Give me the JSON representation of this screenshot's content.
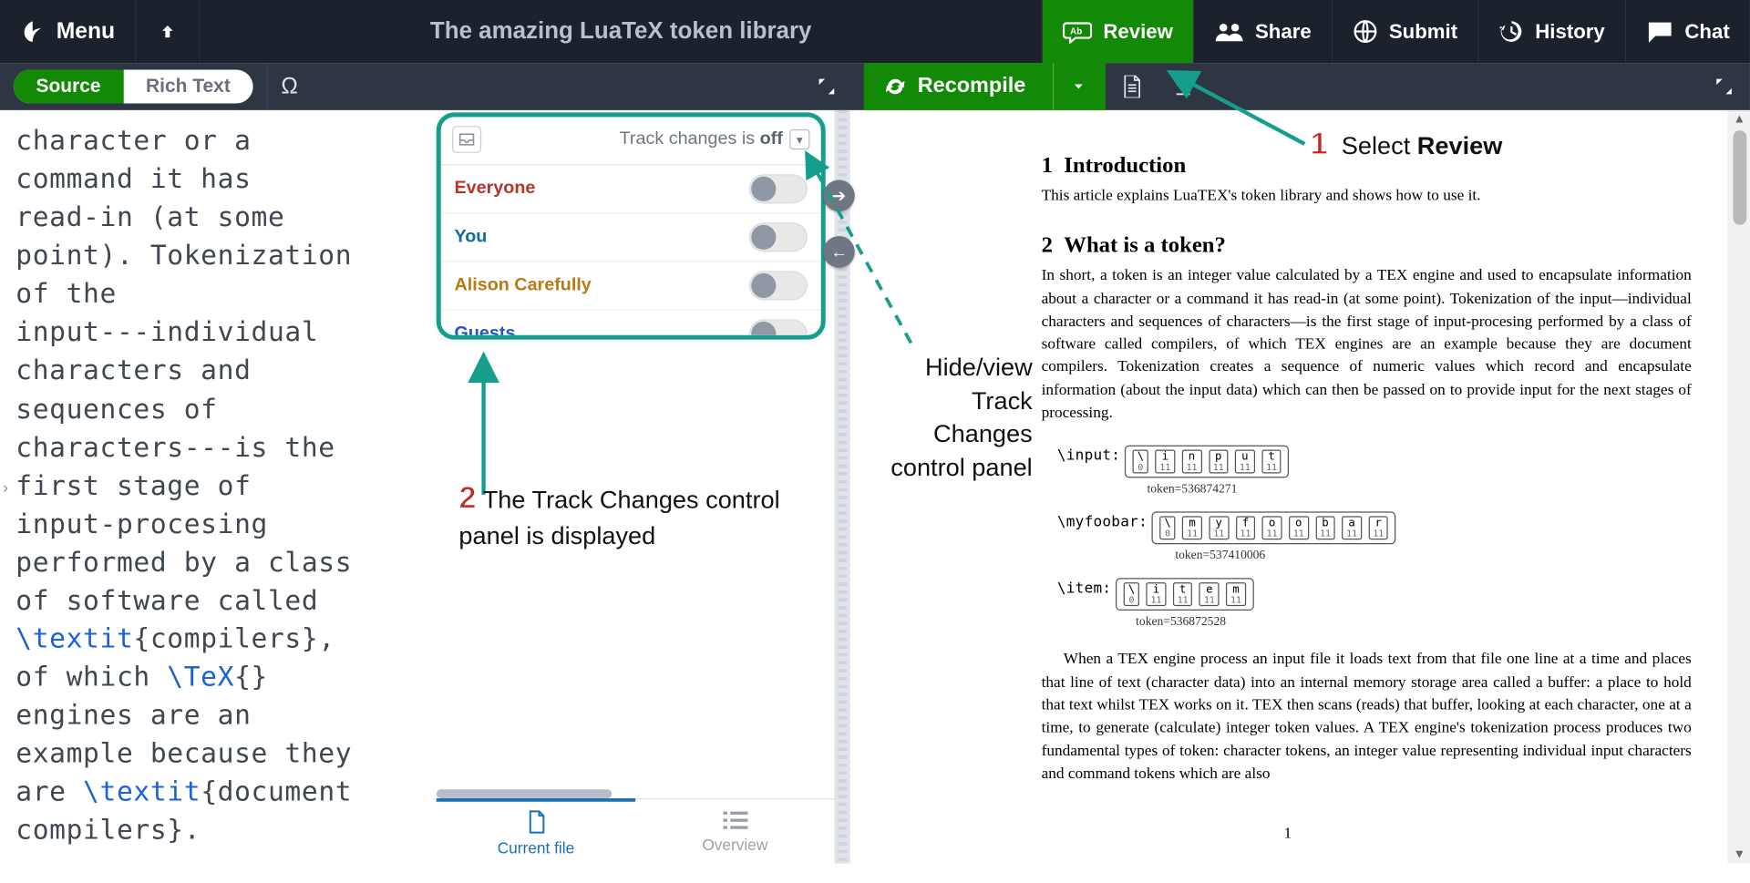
{
  "topbar": {
    "menu": "Menu",
    "title": "The amazing LuaTeX token library",
    "review": "Review",
    "share": "Share",
    "submit": "Submit",
    "history": "History",
    "chat": "Chat"
  },
  "subbar": {
    "source": "Source",
    "rich": "Rich Text",
    "omega": "Ω",
    "recompile": "Recompile"
  },
  "editor_code_html": "character or a\ncommand it has\nread-in (at some\npoint). Tokenization\nof the\ninput---individual\ncharacters and\nsequences of\ncharacters---is the\nfirst stage of\ninput-procesing\nperformed by a class\nof software called\n<span class=\"cmd\">\\textit</span>{compilers},\nof which <span class=\"cmd\">\\TeX</span>{}\nengines are an\nexample because they\nare <span class=\"cmd\">\\textit</span>{document\ncompilers}.",
  "track": {
    "status_prefix": "Track changes is ",
    "status_value": "off",
    "rows": [
      {
        "name": "Everyone",
        "cls": "red"
      },
      {
        "name": "You",
        "cls": "blue"
      },
      {
        "name": "Alison Carefully",
        "cls": "orange"
      },
      {
        "name": "Guests",
        "cls": "royal"
      }
    ],
    "tab_current": "Current file",
    "tab_overview": "Overview"
  },
  "pdf": {
    "sec1_num": "1",
    "sec1": "Introduction",
    "p1": "This article explains LuaTEX's token library and shows how to use it.",
    "sec2_num": "2",
    "sec2": "What is a token?",
    "p2": "In short, a token is an integer value calculated by a TEX engine and used to encapsulate information about a character or a command it has read-in (at some point). Tokenization of the input—individual characters and sequences of characters—is the first stage of input-procesing performed by a class of software called compilers, of which TEX engines are an example because they are document compilers. Tokenization creates a sequence of numeric values which record and encapsulate information (about the input data) which can then be passed on to provide input for the next stages of processing.",
    "p3": "When a TEX engine process an input file it loads text from that file one line at a time and places that line of text (character data) into an internal memory storage area called a buffer: a place to hold that text whilst TEX works on it. TEX then scans (reads) that buffer, looking at each character, one at a time, to generate (calculate) integer token values. A TEX engine's tokenization process produces two fundamental types of token: character tokens, an integer value representing individual input characters and command tokens which are also",
    "tok_input": "\\input:",
    "tok_input_val": "token=536874271",
    "tok_myfoo": "\\myfoobar:",
    "tok_myfoo_val": "token=537410006",
    "tok_item": "\\item:",
    "tok_item_val": "token=536872528",
    "pagenum": "1"
  },
  "annotations": {
    "one": "1",
    "one_text_a": "Select ",
    "one_text_b": "Review",
    "two": "2",
    "two_text": "The Track Changes control panel is displayed",
    "hide_text": "Hide/view Track Changes control panel"
  }
}
